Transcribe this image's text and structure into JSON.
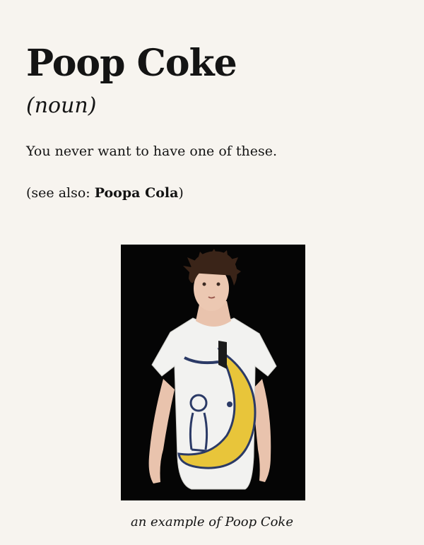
{
  "entry": {
    "term": "Poop Coke",
    "part_of_speech": "(noun)",
    "definition": "You never want to have one of these.",
    "see_also_prefix": "(see also: ",
    "see_also_term": "Poopa Cola",
    "see_also_suffix": ")"
  },
  "figure": {
    "caption": "an example of Poop Coke"
  },
  "colors": {
    "background": "#f7f4ef",
    "text": "#141414",
    "photo_background": "#050505",
    "moon_yellow": "#e8c53a"
  }
}
